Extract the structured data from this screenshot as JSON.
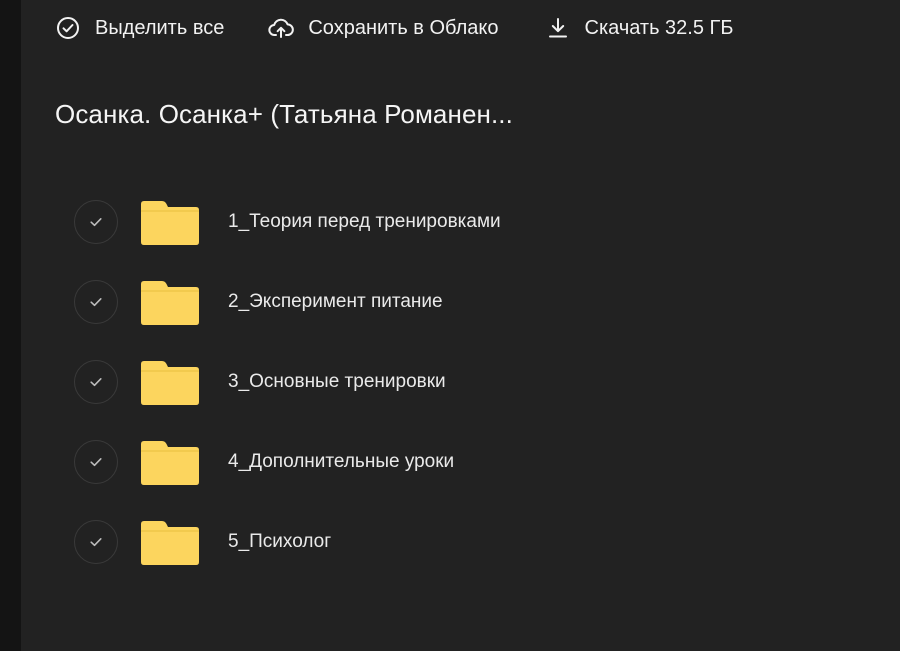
{
  "toolbar": {
    "select_all": "Выделить все",
    "save_cloud": "Сохранить в Облако",
    "download": "Скачать 32.5 ГБ",
    "icons": [
      "check-circle-icon",
      "cloud-upload-icon",
      "download-icon"
    ]
  },
  "folder_title": "Осанка. Осанка+ (Татьяна Романен...",
  "items": [
    {
      "name": "1_Теория перед тренировками",
      "icon": "folder-icon"
    },
    {
      "name": "2_Эксперимент питание",
      "icon": "folder-icon"
    },
    {
      "name": "3_Основные тренировки",
      "icon": "folder-icon"
    },
    {
      "name": "4_Дополнительные уроки",
      "icon": "folder-icon"
    },
    {
      "name": "5_Психолог",
      "icon": "folder-icon"
    }
  ],
  "colors": {
    "background": "#222222",
    "folder": "#FCD55E",
    "text": "#F2F2F2"
  }
}
